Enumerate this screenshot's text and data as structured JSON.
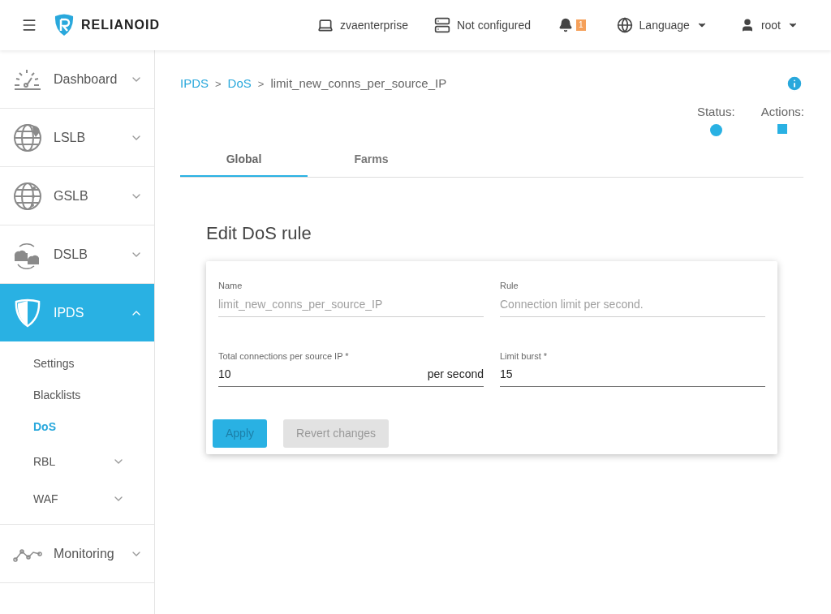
{
  "header": {
    "logo": "RELIANOID",
    "host": "zvaenterprise",
    "cluster": "Not configured",
    "notifications": "1",
    "language": "Language",
    "user": "root"
  },
  "sidebar": {
    "items": [
      {
        "label": "Dashboard",
        "kind": "dashboard",
        "expanded": false,
        "selected": false
      },
      {
        "label": "LSLB",
        "kind": "lslb",
        "expanded": false,
        "selected": false
      },
      {
        "label": "GSLB",
        "kind": "gslb",
        "expanded": false,
        "selected": false
      },
      {
        "label": "DSLB",
        "kind": "dslb",
        "expanded": false,
        "selected": false
      },
      {
        "label": "IPDS",
        "kind": "ipds",
        "expanded": true,
        "selected": true,
        "children": [
          {
            "label": "Settings",
            "selected": false,
            "has_submenu": false
          },
          {
            "label": "Blacklists",
            "selected": false,
            "has_submenu": false
          },
          {
            "label": "DoS",
            "selected": true,
            "has_submenu": false
          },
          {
            "label": "RBL",
            "selected": false,
            "has_submenu": true
          },
          {
            "label": "WAF",
            "selected": false,
            "has_submenu": true
          }
        ]
      },
      {
        "label": "Monitoring",
        "kind": "monitoring",
        "expanded": false,
        "selected": false
      }
    ]
  },
  "breadcrumb": [
    {
      "label": "IPDS",
      "link": true
    },
    {
      "separator": ">",
      "label": "DoS",
      "link": true
    },
    {
      "separator": ">",
      "label": "limit_new_conns_per_source_IP",
      "link": false
    }
  ],
  "status": {
    "status_label": "Status:",
    "actions_label": "Actions:"
  },
  "tabs": [
    {
      "label": "Global",
      "selected": true
    },
    {
      "label": "Farms",
      "selected": false
    }
  ],
  "form": {
    "title": "Edit DoS rule",
    "fields": [
      {
        "label": "Name",
        "value": "limit_new_conns_per_source_IP",
        "disabled": true
      },
      {
        "label": "Rule",
        "value": "Connection limit per second.",
        "disabled": true
      },
      {
        "label": "Total connections per source IP *",
        "value": "10",
        "suffix": "per second",
        "disabled": false
      },
      {
        "label": "Limit burst *",
        "value": "15",
        "disabled": false
      }
    ],
    "buttons": [
      {
        "label": "Apply",
        "kind": "primary",
        "disabled": true
      },
      {
        "label": "Revert changes",
        "kind": "secondary",
        "disabled": true
      }
    ]
  }
}
